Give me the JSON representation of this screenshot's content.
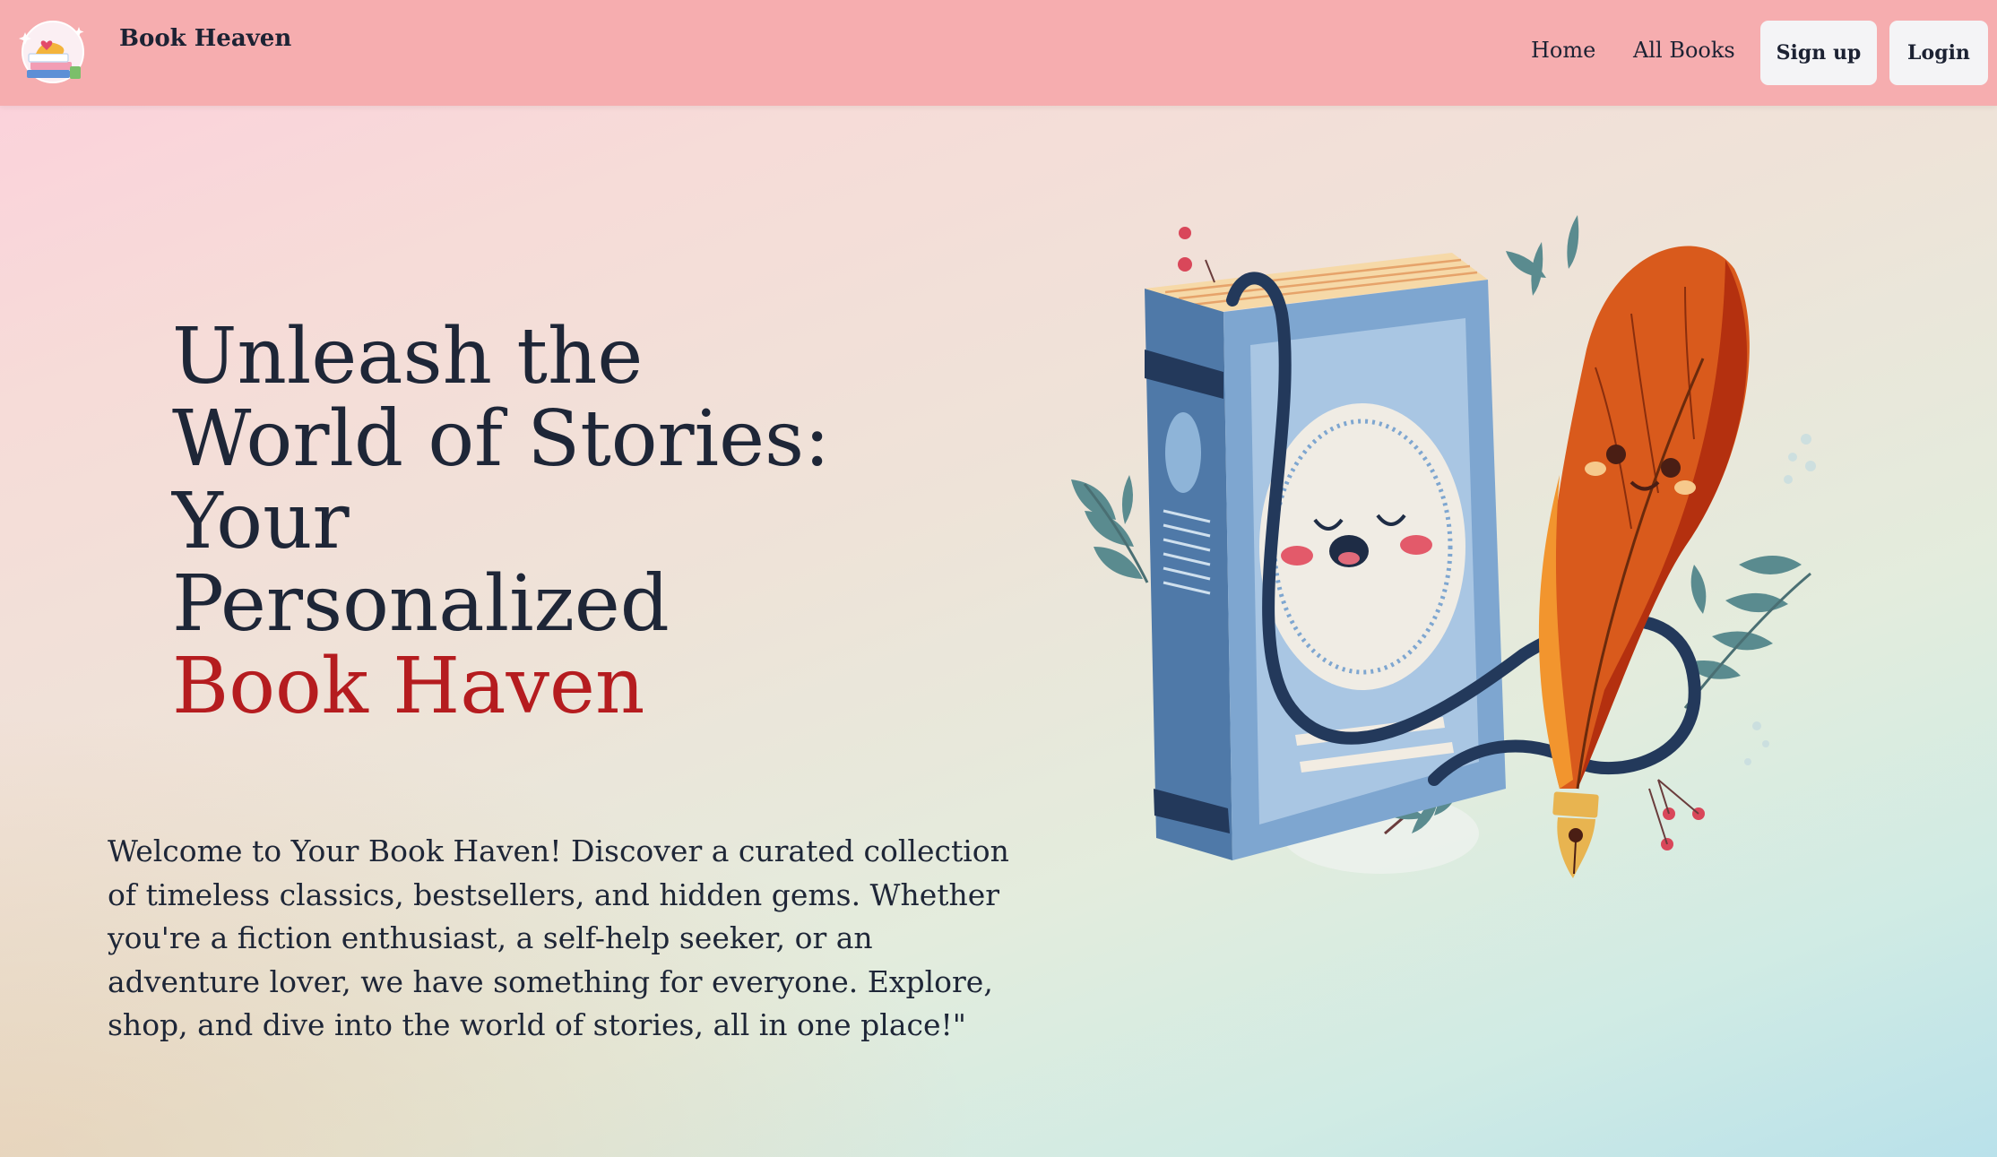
{
  "navbar": {
    "brand_name": "Book Heaven",
    "logo_icon": "book-stack-logo-icon",
    "links": [
      {
        "label": "Home"
      },
      {
        "label": "All Books"
      }
    ],
    "signup_label": "Sign up",
    "login_label": "Login",
    "background_color": "#f6adaf"
  },
  "hero": {
    "title_lines": [
      "Unleash the",
      "World of Stories:",
      "Your",
      "Personalized"
    ],
    "title_accent": "Book Haven",
    "accent_color": "#b51c1f",
    "description": "Welcome to Your Book Haven! Discover a curated collection of timeless classics, bestsellers, and hidden gems. Whether you're a fiction enthusiast, a self-help seeker, or an adventure lover, we have something for everyone. Explore, shop, and dive into the world of stories, all in one place!\"",
    "illustration_icon": "smiling-book-and-quill-illustration"
  }
}
